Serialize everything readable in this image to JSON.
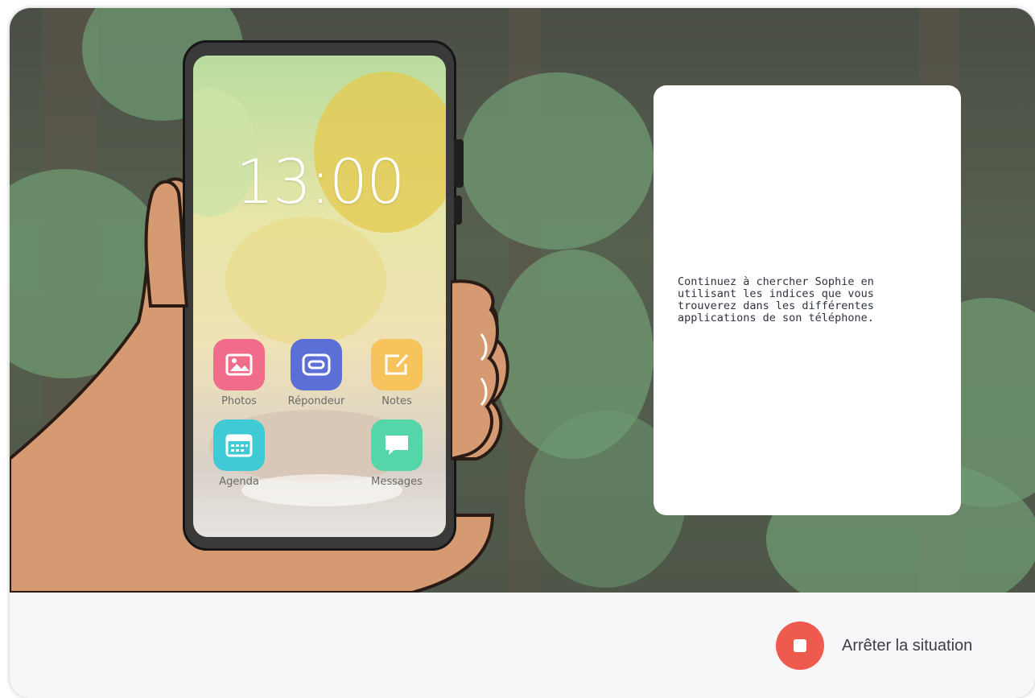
{
  "phone": {
    "time": "13:00",
    "apps": [
      {
        "label": "Photos",
        "icon": "photo-icon",
        "color": "#f06c8a"
      },
      {
        "label": "Répondeur",
        "icon": "voicemail-icon",
        "color": "#5b6fd6"
      },
      {
        "label": "Notes",
        "icon": "note-icon",
        "color": "#f7c35c"
      },
      {
        "label": "Agenda",
        "icon": "calendar-icon",
        "color": "#3fcad6"
      },
      {
        "label": "Messages",
        "icon": "message-icon",
        "color": "#55d6a8"
      }
    ]
  },
  "instruction": {
    "text": "Continuez à chercher Sophie en\nutilisant les indices que vous\ntrouverez dans les différentes\napplications de son téléphone."
  },
  "footer": {
    "stop_label": "Arrêter la situation",
    "stop_color": "#ef5a4e"
  }
}
